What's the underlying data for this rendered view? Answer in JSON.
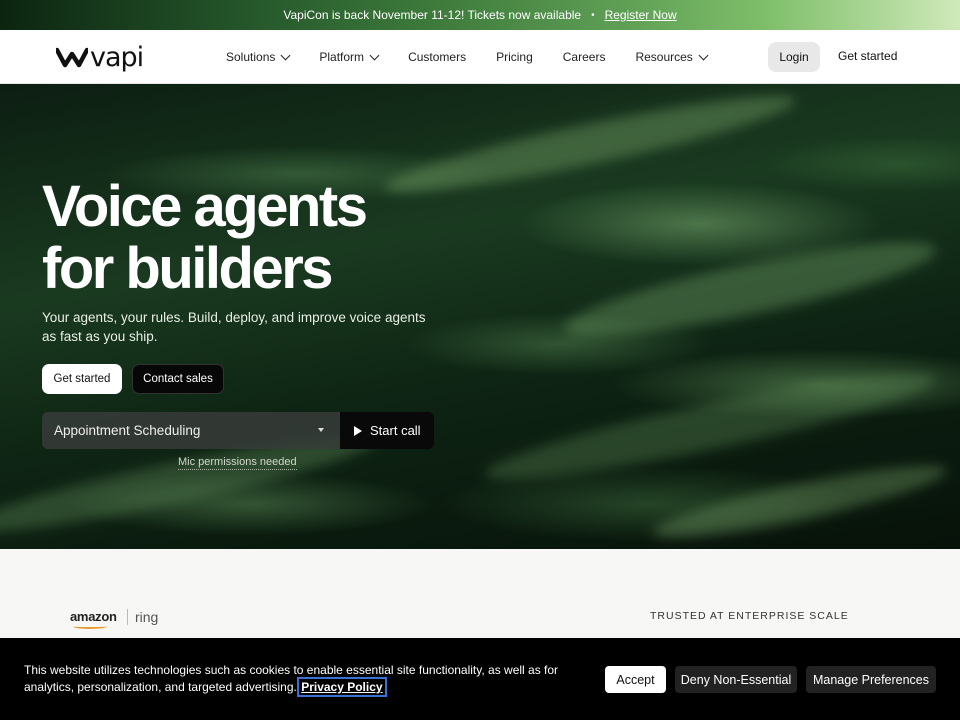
{
  "announcement": {
    "text": "VapiCon is back November 11-12! Tickets now available",
    "separator": "•",
    "link": "Register Now"
  },
  "nav": {
    "logo": "vapi",
    "links": [
      {
        "label": "Solutions",
        "dropdown": true
      },
      {
        "label": "Platform",
        "dropdown": true
      },
      {
        "label": "Customers",
        "dropdown": false
      },
      {
        "label": "Pricing",
        "dropdown": false
      },
      {
        "label": "Careers",
        "dropdown": false
      },
      {
        "label": "Resources",
        "dropdown": true
      }
    ],
    "login": "Login",
    "get_started": "Get started"
  },
  "hero": {
    "title_line1": "Voice agents",
    "title_line2": "for builders",
    "subtitle": "Your agents, your rules. Build, deploy, and improve voice agents as fast as you ship.",
    "primary_button": "Get started",
    "secondary_button": "Contact sales",
    "selector_value": "Appointment Scheduling",
    "start_call": "Start call",
    "mic_note": "Mic permissions needed"
  },
  "trusted": {
    "logos": [
      "amazon",
      "ring"
    ],
    "label": "TRUSTED AT ENTERPRISE SCALE"
  },
  "cookie": {
    "text": "This website utilizes technologies such as cookies to enable essential site functionality, as well as for analytics, personalization, and targeted advertising.",
    "policy_link": "Privacy Policy",
    "accept": "Accept",
    "deny": "Deny Non-Essential",
    "manage": "Manage Preferences"
  },
  "colors": {
    "accent_green": "#2f6b34",
    "cookie_bg": "#000000",
    "focus_outline": "#3b6fd8"
  },
  "icons": [
    "vapi-logo-icon",
    "chevron-down-icon",
    "caret-down-icon",
    "play-icon",
    "amazon-smile-icon"
  ]
}
